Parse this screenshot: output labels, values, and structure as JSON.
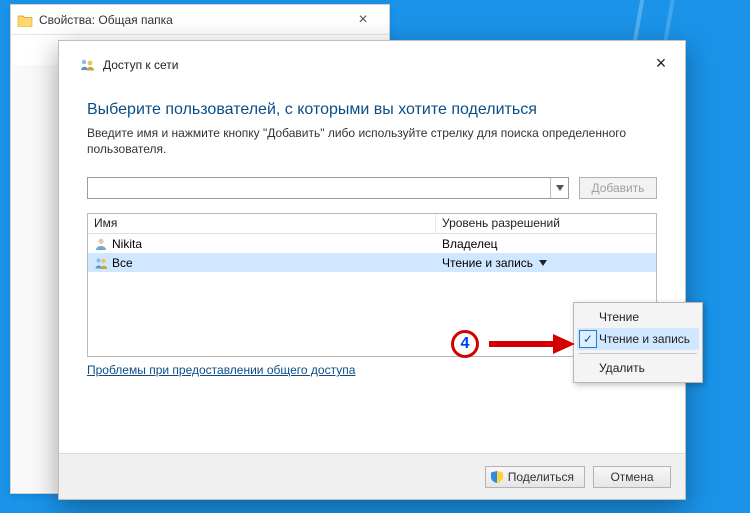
{
  "props_window": {
    "title": "Свойства: Общая папка"
  },
  "dialog": {
    "title": "Доступ к сети",
    "heading": "Выберите пользователей, с которыми вы хотите поделиться",
    "description": "Введите имя и нажмите кнопку \"Добавить\" либо используйте стрелку для поиска определенного пользователя.",
    "add_button": "Добавить",
    "add_input_value": "",
    "columns": {
      "name": "Имя",
      "perm": "Уровень разрешений"
    },
    "rows": [
      {
        "icon": "user",
        "name": "Nikita",
        "perm": "Владелец",
        "dropdown": false,
        "selected": false
      },
      {
        "icon": "group",
        "name": "Все",
        "perm": "Чтение и запись",
        "dropdown": true,
        "selected": true
      }
    ],
    "trouble_link": "Проблемы при предоставлении общего доступа",
    "share_button": "Поделиться",
    "cancel_button": "Отмена"
  },
  "perm_menu": {
    "items": [
      {
        "label": "Чтение",
        "checked": false
      },
      {
        "label": "Чтение и запись",
        "checked": true
      }
    ],
    "delete": "Удалить"
  },
  "annotation": {
    "badge": "4"
  }
}
